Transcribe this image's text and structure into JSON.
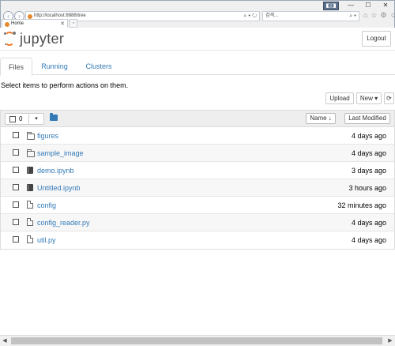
{
  "browser": {
    "url": "http://localhost:8888/tree",
    "search_text": "검색...",
    "tab_title": "Home",
    "new_tab_glyph": "▫",
    "address_tools": "⌕ ▾ ↻",
    "search_go": "⌕ ▾",
    "back_glyph": "‹",
    "forward_glyph": "›",
    "win_controls": [
      "—",
      "☐",
      "✕"
    ],
    "compat_glyph": "◧◨",
    "toolbar_icons": [
      "⌂",
      "☆",
      "⚙",
      "☺"
    ],
    "tab_close": "✕"
  },
  "header": {
    "logo_text": "jupyter",
    "logout_label": "Logout"
  },
  "tabs": [
    {
      "label": "Files",
      "active": true
    },
    {
      "label": "Running",
      "active": false
    },
    {
      "label": "Clusters",
      "active": false
    }
  ],
  "instructions": "Select items to perform actions on them.",
  "toolbar": {
    "upload_label": "Upload",
    "new_label": "New ▾",
    "refresh_glyph": "⟳"
  },
  "list_header": {
    "selected_count": "0",
    "dropdown_glyph": "▾",
    "name_sort_label": "Name ↓",
    "last_modified_label": "Last Modified"
  },
  "files": [
    {
      "name": "figures",
      "type": "folder",
      "modified": "4 days ago"
    },
    {
      "name": "sample_image",
      "type": "folder",
      "modified": "4 days ago"
    },
    {
      "name": "demo.ipynb",
      "type": "notebook",
      "modified": "3 days ago"
    },
    {
      "name": "Untitled.ipynb",
      "type": "notebook",
      "modified": "3 hours ago"
    },
    {
      "name": "config",
      "type": "file",
      "modified": "32 minutes ago"
    },
    {
      "name": "config_reader.py",
      "type": "file",
      "modified": "4 days ago"
    },
    {
      "name": "util.py",
      "type": "file",
      "modified": "4 days ago"
    }
  ],
  "scrollbar": {
    "left_arrow": "◀",
    "right_arrow": "▶"
  }
}
